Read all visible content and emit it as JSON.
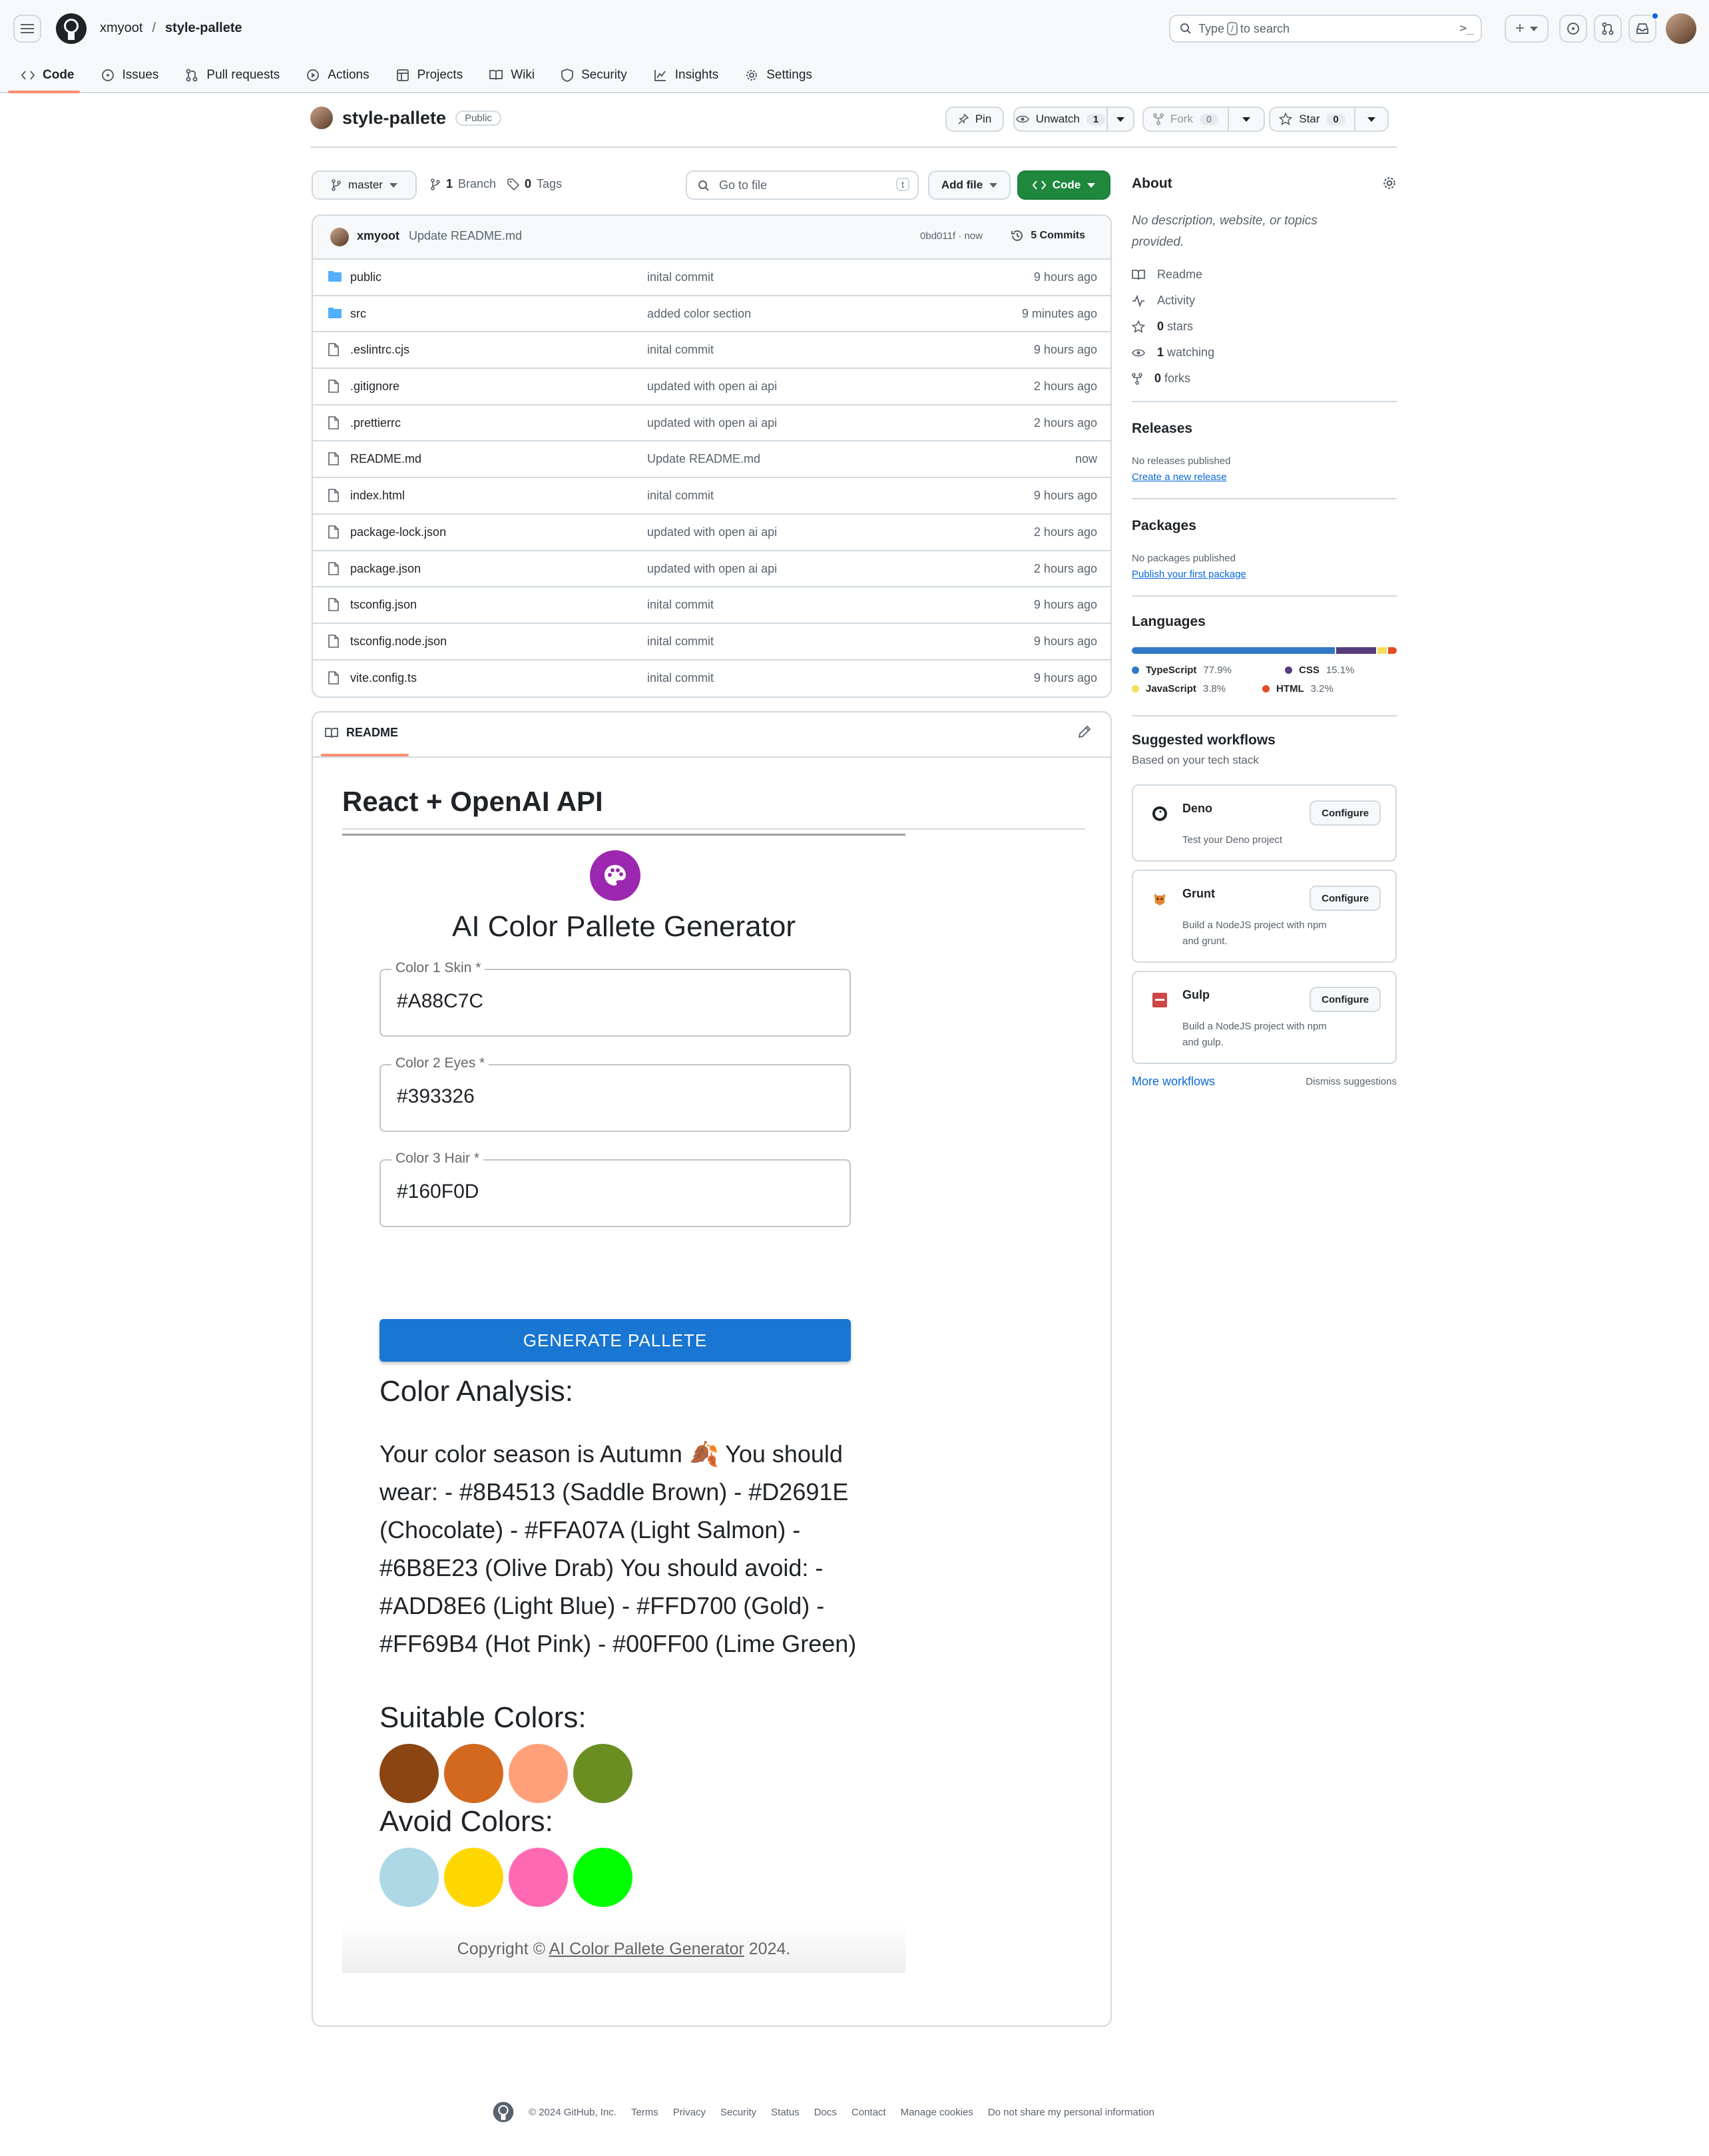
{
  "header": {
    "owner": "xmyoot",
    "separator": "/",
    "repo": "style-pallete",
    "search_prefix": "Type",
    "search_key": "/",
    "search_suffix": "to search"
  },
  "tabs": [
    {
      "label": "Code"
    },
    {
      "label": "Issues"
    },
    {
      "label": "Pull requests"
    },
    {
      "label": "Actions"
    },
    {
      "label": "Projects"
    },
    {
      "label": "Wiki"
    },
    {
      "label": "Security"
    },
    {
      "label": "Insights"
    },
    {
      "label": "Settings"
    }
  ],
  "repo_bar": {
    "name": "style-pallete",
    "visibility": "Public",
    "pin": "Pin",
    "unwatch": "Unwatch",
    "watch_count": "1",
    "fork": "Fork",
    "fork_count": "0",
    "star": "Star",
    "star_count": "0"
  },
  "toolbar": {
    "branch": "master",
    "branches_count": "1",
    "branches_label": "Branch",
    "tags_count": "0",
    "tags_label": "Tags",
    "goto_placeholder": "Go to file",
    "goto_key": "t",
    "add_file": "Add file",
    "code": "Code"
  },
  "latest_commit": {
    "author": "xmyoot",
    "message": "Update README.md",
    "hash_time": "0bd011f · now",
    "commits": "5 Commits"
  },
  "files": [
    {
      "name": "public",
      "type": "dir",
      "message": "inital commit",
      "time": "9 hours ago"
    },
    {
      "name": "src",
      "type": "dir",
      "message": "added color section",
      "time": "9 minutes ago"
    },
    {
      "name": ".eslintrc.cjs",
      "type": "file",
      "message": "inital commit",
      "time": "9 hours ago"
    },
    {
      "name": ".gitignore",
      "type": "file",
      "message": "updated with open ai api",
      "time": "2 hours ago"
    },
    {
      "name": ".prettierrc",
      "type": "file",
      "message": "updated with open ai api",
      "time": "2 hours ago"
    },
    {
      "name": "README.md",
      "type": "file",
      "message": "Update README.md",
      "time": "now"
    },
    {
      "name": "index.html",
      "type": "file",
      "message": "inital commit",
      "time": "9 hours ago"
    },
    {
      "name": "package-lock.json",
      "type": "file",
      "message": "updated with open ai api",
      "time": "2 hours ago"
    },
    {
      "name": "package.json",
      "type": "file",
      "message": "updated with open ai api",
      "time": "2 hours ago"
    },
    {
      "name": "tsconfig.json",
      "type": "file",
      "message": "inital commit",
      "time": "9 hours ago"
    },
    {
      "name": "tsconfig.node.json",
      "type": "file",
      "message": "inital commit",
      "time": "9 hours ago"
    },
    {
      "name": "vite.config.ts",
      "type": "file",
      "message": "inital commit",
      "time": "9 hours ago"
    }
  ],
  "readme": {
    "tab": "README",
    "heading": "React + OpenAI API",
    "app": {
      "title": "AI Color Pallete Generator",
      "fields": [
        {
          "label": "Color 1 Skin *",
          "value": "#A88C7C"
        },
        {
          "label": "Color 2 Eyes *",
          "value": "#393326"
        },
        {
          "label": "Color 3 Hair *",
          "value": "#160F0D"
        }
      ],
      "button": "GENERATE PALLETE",
      "analysis_heading": "Color Analysis:",
      "analysis_text": "Your color season is Autumn 🍂 You should wear: - #8B4513 (Saddle Brown) - #D2691E (Chocolate) - #FFA07A (Light Salmon) - #6B8E23 (Olive Drab) You should avoid: - #ADD8E6 (Light Blue) - #FFD700 (Gold) - #FF69B4 (Hot Pink) - #00FF00 (Lime Green)",
      "suitable_heading": "Suitable Colors:",
      "suitable_colors": [
        "#8B4513",
        "#D2691E",
        "#FFA07A",
        "#6B8E23"
      ],
      "avoid_heading": "Avoid Colors:",
      "avoid_colors": [
        "#ADD8E6",
        "#FFD700",
        "#FF69B4",
        "#00FF00"
      ],
      "copyright_prefix": "Copyright ©",
      "copyright_link": "AI Color Pallete Generator",
      "copyright_suffix": "2024."
    }
  },
  "sidebar": {
    "about_title": "About",
    "about_desc": "No description, website, or topics provided.",
    "items": [
      {
        "bold": "",
        "text": "Readme"
      },
      {
        "bold": "",
        "text": "Activity"
      },
      {
        "bold": "0",
        "text": "stars"
      },
      {
        "bold": "1",
        "text": "watching"
      },
      {
        "bold": "0",
        "text": "forks"
      }
    ],
    "releases_title": "Releases",
    "releases_text": "No releases published",
    "releases_link": "Create a new release",
    "packages_title": "Packages",
    "packages_text": "No packages published",
    "packages_link": "Publish your first package",
    "languages_title": "Languages",
    "languages": [
      {
        "name": "TypeScript",
        "percent": "77.9%",
        "value": 77.9,
        "color": "#3178c6"
      },
      {
        "name": "CSS",
        "percent": "15.1%",
        "value": 15.1,
        "color": "#563d7c"
      },
      {
        "name": "JavaScript",
        "percent": "3.8%",
        "value": 3.8,
        "color": "#f1e05a"
      },
      {
        "name": "HTML",
        "percent": "3.2%",
        "value": 3.2,
        "color": "#e34c26"
      }
    ],
    "workflows_title": "Suggested workflows",
    "workflows_sub": "Based on your tech stack",
    "workflows": [
      {
        "name": "Deno",
        "desc": "Test your Deno project",
        "button": "Configure"
      },
      {
        "name": "Grunt",
        "desc": "Build a NodeJS project with npm and grunt.",
        "button": "Configure"
      },
      {
        "name": "Gulp",
        "desc": "Build a NodeJS project with npm and gulp.",
        "button": "Configure"
      }
    ],
    "more_workflows": "More workflows",
    "dismiss": "Dismiss suggestions"
  },
  "footer": {
    "copyright": "© 2024 GitHub, Inc.",
    "links": [
      "Terms",
      "Privacy",
      "Security",
      "Status",
      "Docs",
      "Contact",
      "Manage cookies",
      "Do not share my personal information"
    ]
  }
}
